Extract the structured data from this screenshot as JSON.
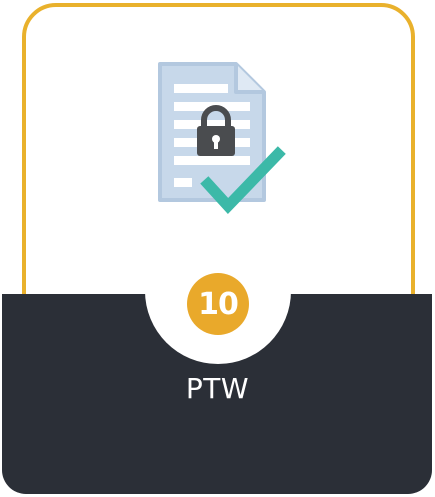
{
  "card": {
    "number": "10",
    "title": "PTW"
  },
  "icon": {
    "name": "locked-document-checkmark-icon"
  },
  "colors": {
    "border": "#e9b12c",
    "badge": "#e9a92b",
    "dark": "#2b2f37",
    "check": "#3cb9a8",
    "paper": "#b9cde4",
    "lock": "#4a4c4f"
  }
}
